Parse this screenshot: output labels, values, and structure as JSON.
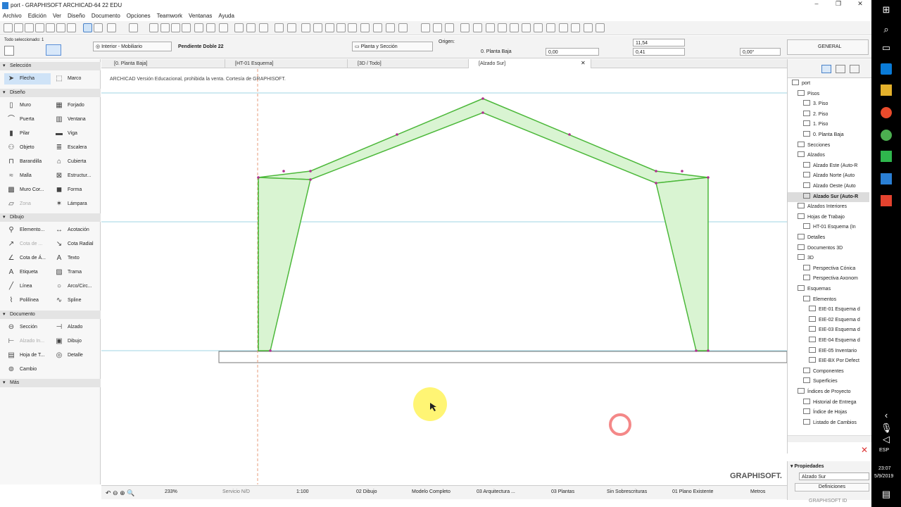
{
  "window": {
    "title": "port - GRAPHISOFT ARCHICAD-64 22 EDU",
    "menu": [
      "Archivo",
      "Edición",
      "Ver",
      "Diseño",
      "Documento",
      "Opciones",
      "Teamwork",
      "Ventanas",
      "Ayuda"
    ]
  },
  "infobox": {
    "selected_info": "Todo seleccionado: 1",
    "layer": "Interior - Mobiliario",
    "profile": "Pendiente Doble 22",
    "view_mode": "Planta y Sección",
    "origin_label": "Origen:",
    "origin_value": "0. Planta Baja",
    "offset_value": "0,00",
    "dim1": "11,54",
    "dim2": "0,41",
    "angle": "0,00°",
    "general": "GENERAL"
  },
  "tabs": [
    {
      "label": "[0. Planta Baja]",
      "active": false
    },
    {
      "label": "[HT-01 Esquema]",
      "active": false
    },
    {
      "label": "[3D / Todo]",
      "active": false
    },
    {
      "label": "[Alzado Sur]",
      "active": true
    }
  ],
  "toolbox": {
    "sections": {
      "seleccion": "Selección",
      "diseno": "Diseño",
      "dibujo": "Dibujo",
      "documento": "Documento",
      "mas": "Más"
    },
    "seleccion_tools": [
      "Flecha",
      "Marco"
    ],
    "diseno_tools": [
      "Muro",
      "Forjado",
      "Puerta",
      "Ventana",
      "Pilar",
      "Viga",
      "Objeto",
      "Escalera",
      "Barandilla",
      "Cubierta",
      "Malla",
      "Estructur...",
      "Muro Cor...",
      "Forma",
      "Zona",
      "Lámpara"
    ],
    "dibujo_tools": [
      "Elemento...",
      "Acotación",
      "Cota de ...",
      "Cota Radial",
      "Cota de Á...",
      "Texto",
      "Etiqueta",
      "Trama",
      "Línea",
      "Arco/Circ...",
      "Polilínea",
      "Spline"
    ],
    "documento_tools": [
      "Sección",
      "Alzado",
      "Alzado In...",
      "Dibujo",
      "Hoja de T...",
      "Detalle",
      "Cambio"
    ]
  },
  "canvas": {
    "watermark": "ARCHICAD Versión Educacional, prohibida la venta. Cortesía de GRAPHISOFT.",
    "brand": "GRAPHISOFT."
  },
  "statusbar": {
    "zoom": "233%",
    "service": "Servicio N/D",
    "scale": "1:100",
    "layer_combo": "02 Dibujo",
    "model": "Modelo Completo",
    "structure": "03 Arquitectura ...",
    "floors": "03 Plantas",
    "overrides": "Sin Sobrescrituras",
    "renovation": "01 Plano Existente",
    "units": "Metros"
  },
  "navigator": {
    "items": [
      {
        "label": "port",
        "level": 0
      },
      {
        "label": "Pisos",
        "level": 1
      },
      {
        "label": "3. Piso",
        "level": 2
      },
      {
        "label": "2. Piso",
        "level": 2
      },
      {
        "label": "1. Piso",
        "level": 2
      },
      {
        "label": "0. Planta Baja",
        "level": 2
      },
      {
        "label": "Secciones",
        "level": 1
      },
      {
        "label": "Alzados",
        "level": 1
      },
      {
        "label": "Alzado Este (Auto-R",
        "level": 2
      },
      {
        "label": "Alzado Norte (Auto",
        "level": 2
      },
      {
        "label": "Alzado Oeste (Auto",
        "level": 2
      },
      {
        "label": "Alzado Sur (Auto-R",
        "level": 2,
        "selected": true
      },
      {
        "label": "Alzados Interiores",
        "level": 1
      },
      {
        "label": "Hojas de Trabajo",
        "level": 1
      },
      {
        "label": "HT-01 Esquema (In",
        "level": 2
      },
      {
        "label": "Detalles",
        "level": 1
      },
      {
        "label": "Documentos 3D",
        "level": 1
      },
      {
        "label": "3D",
        "level": 1
      },
      {
        "label": "Perspectiva Cónica",
        "level": 2
      },
      {
        "label": "Perspectiva Axonom",
        "level": 2
      },
      {
        "label": "Esquemas",
        "level": 1
      },
      {
        "label": "Elementos",
        "level": 2
      },
      {
        "label": "EIE-01 Esquema d",
        "level": 3
      },
      {
        "label": "EIE-02 Esquema d",
        "level": 3
      },
      {
        "label": "EIE-03 Esquema d",
        "level": 3
      },
      {
        "label": "EIE-04 Esquema d",
        "level": 3
      },
      {
        "label": "EIE-05 Inventario",
        "level": 3
      },
      {
        "label": "EIE-BX Por Defect",
        "level": 3
      },
      {
        "label": "Componentes",
        "level": 2
      },
      {
        "label": "Superficies",
        "level": 2
      },
      {
        "label": "Índices de Proyecto",
        "level": 1
      },
      {
        "label": "Historial de Entrega",
        "level": 2
      },
      {
        "label": "Índice de Hojas",
        "level": 2
      },
      {
        "label": "Listado de Cambios",
        "level": 2
      }
    ]
  },
  "properties": {
    "header": "Propiedades",
    "value": "Alzado Sur",
    "button": "Definiciones",
    "footer": "GRAPHISOFT ID"
  },
  "taskbar": {
    "lang": "ESP",
    "time": "23:07",
    "date": "5/9/2019"
  }
}
